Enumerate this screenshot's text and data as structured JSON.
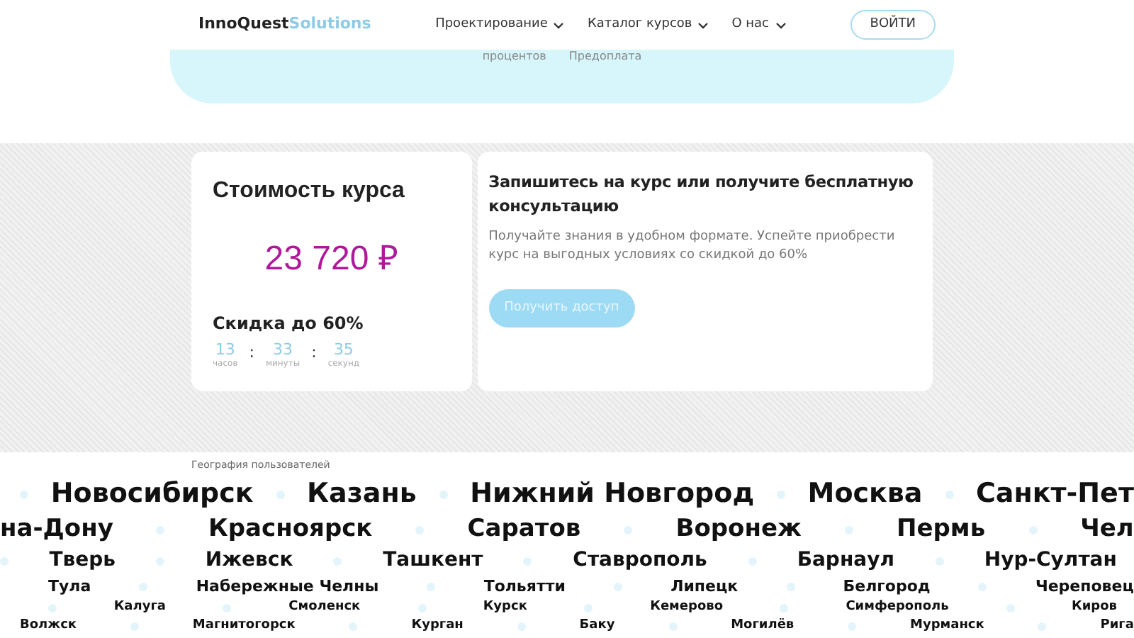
{
  "header": {
    "logo": {
      "main": "InnoQuest",
      "accent": "Solutions"
    },
    "nav": [
      {
        "label": "Проектирование"
      },
      {
        "label": "Каталог курсов"
      },
      {
        "label": "О нас"
      }
    ],
    "login_button": "ВОЙТИ"
  },
  "hero_panel": {
    "texts": [
      "процентов",
      "Предоплата"
    ]
  },
  "price_card": {
    "title": "Стоимость курса",
    "price": "23 720 ₽",
    "discount": "Скидка до 60%",
    "timer": [
      {
        "value": "13",
        "unit": "часов"
      },
      {
        "value": "33",
        "unit": "минуты"
      },
      {
        "value": "35",
        "unit": "секунд"
      }
    ],
    "separator": ":"
  },
  "signup_card": {
    "title": "Запишитесь на курс или получите бесплатную консультацию",
    "text": "Получайте знания в удобном формате. Успейте приобрести курс на выгодных условиях со скидкой до 60%",
    "button": "Получить доступ"
  },
  "geography": {
    "title": "География пользователей",
    "rows": [
      {
        "cities": [
          "Новосибирск",
          "Казань",
          "Нижний Новгород",
          "Москва",
          "Санкт-Пет"
        ]
      },
      {
        "cities": [
          "на-Дону",
          "Красноярск",
          "Саратов",
          "Воронеж",
          "Пермь",
          "Чел"
        ]
      },
      {
        "cities": [
          "Тверь",
          "Ижевск",
          "Ташкент",
          "Ставрополь",
          "Барнаул",
          "Нур-Султан"
        ]
      },
      {
        "cities": [
          "Тула",
          "Набережные Челны",
          "Тольятти",
          "Липецк",
          "Белгород",
          "Череповец"
        ]
      },
      {
        "cities": [
          "Калуга",
          "Смоленск",
          "Курск",
          "Кемерово",
          "Симферополь",
          "Киров"
        ]
      },
      {
        "cities": [
          "Волжск",
          "Магнитогорск",
          "Курган",
          "Баку",
          "Могилёв",
          "Мурманск",
          "Рига"
        ]
      }
    ]
  }
}
